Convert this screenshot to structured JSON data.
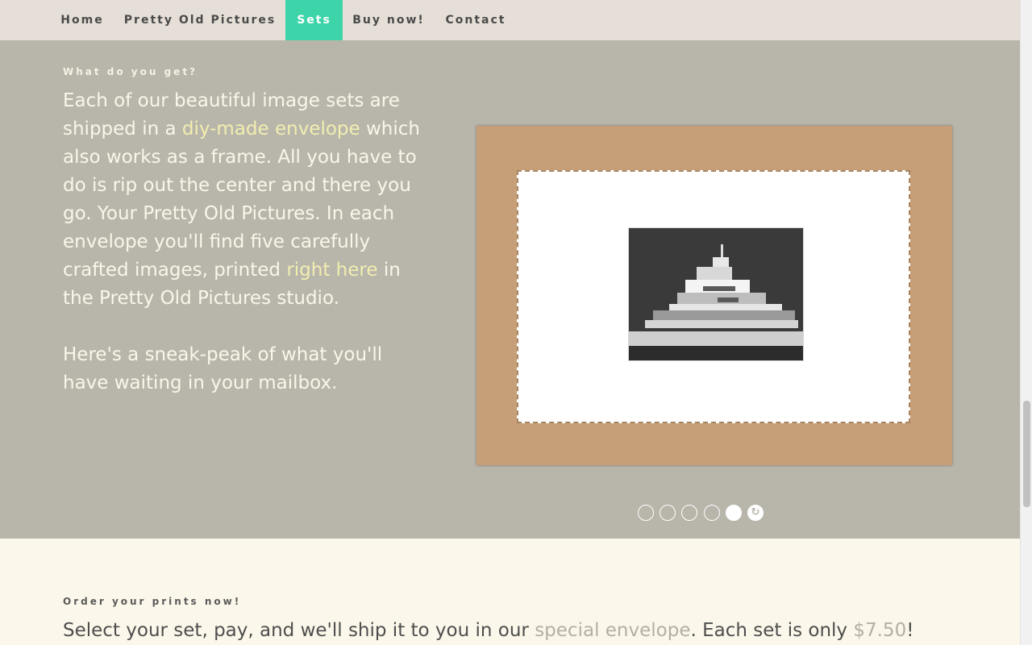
{
  "nav": {
    "items": [
      {
        "label": "Home"
      },
      {
        "label": "Pretty Old Pictures"
      },
      {
        "label": "Sets"
      },
      {
        "label": "Buy now!"
      },
      {
        "label": "Contact"
      }
    ],
    "active_index": 2
  },
  "hero": {
    "eyebrow": "What do you get?",
    "p1_a": "Each of our beautiful image sets are shipped in a ",
    "p1_link1": "diy-made envelope",
    "p1_b": " which also works as a frame. All you have to do is rip out the center and there you go. Your Pretty Old Pictures. In each envelope you'll find five carefully crafted images, printed ",
    "p1_link2": "right here",
    "p1_c": " in the Pretty Old Pictures studio.",
    "p2": "Here's a sneak-peak of what you'll have waiting in your mailbox."
  },
  "slider": {
    "slide_count": 5,
    "current_index": 4,
    "replay_icon": "replay-icon"
  },
  "order": {
    "eyebrow": "Order your prints now!",
    "text_a": "Select your set, pay, and we'll ship it to you in our ",
    "link": "special envelope",
    "text_b": ". Each set is only ",
    "price": "$7.50",
    "text_c": "!"
  },
  "colors": {
    "accent": "#3dd4a9",
    "hero_bg": "#b8b5ab",
    "nav_bg": "#e6dfd7",
    "link_highlight": "#f2eeb0",
    "order_bg": "#fbf7ea"
  }
}
